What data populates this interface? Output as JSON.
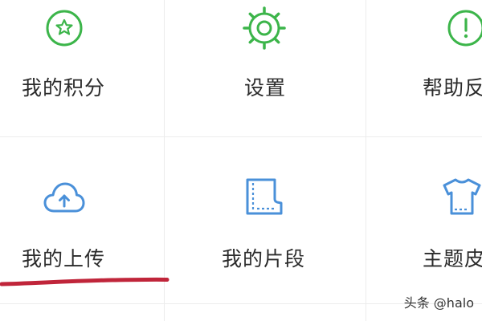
{
  "menu": {
    "items": [
      {
        "label": "我的积分",
        "icon": "star-circle-icon"
      },
      {
        "label": "设置",
        "icon": "gear-icon"
      },
      {
        "label": "帮助反",
        "icon": "exclamation-circle-icon"
      },
      {
        "label": "我的上传",
        "icon": "cloud-upload-icon"
      },
      {
        "label": "我的片段",
        "icon": "film-clip-icon"
      },
      {
        "label": "主题皮",
        "icon": "tshirt-icon"
      }
    ]
  },
  "watermark": {
    "text": "头条 @halo"
  },
  "colors": {
    "green": "#3cb54a",
    "blue": "#4a90d9",
    "annotation": "#c0253a",
    "divider": "#ececec"
  }
}
